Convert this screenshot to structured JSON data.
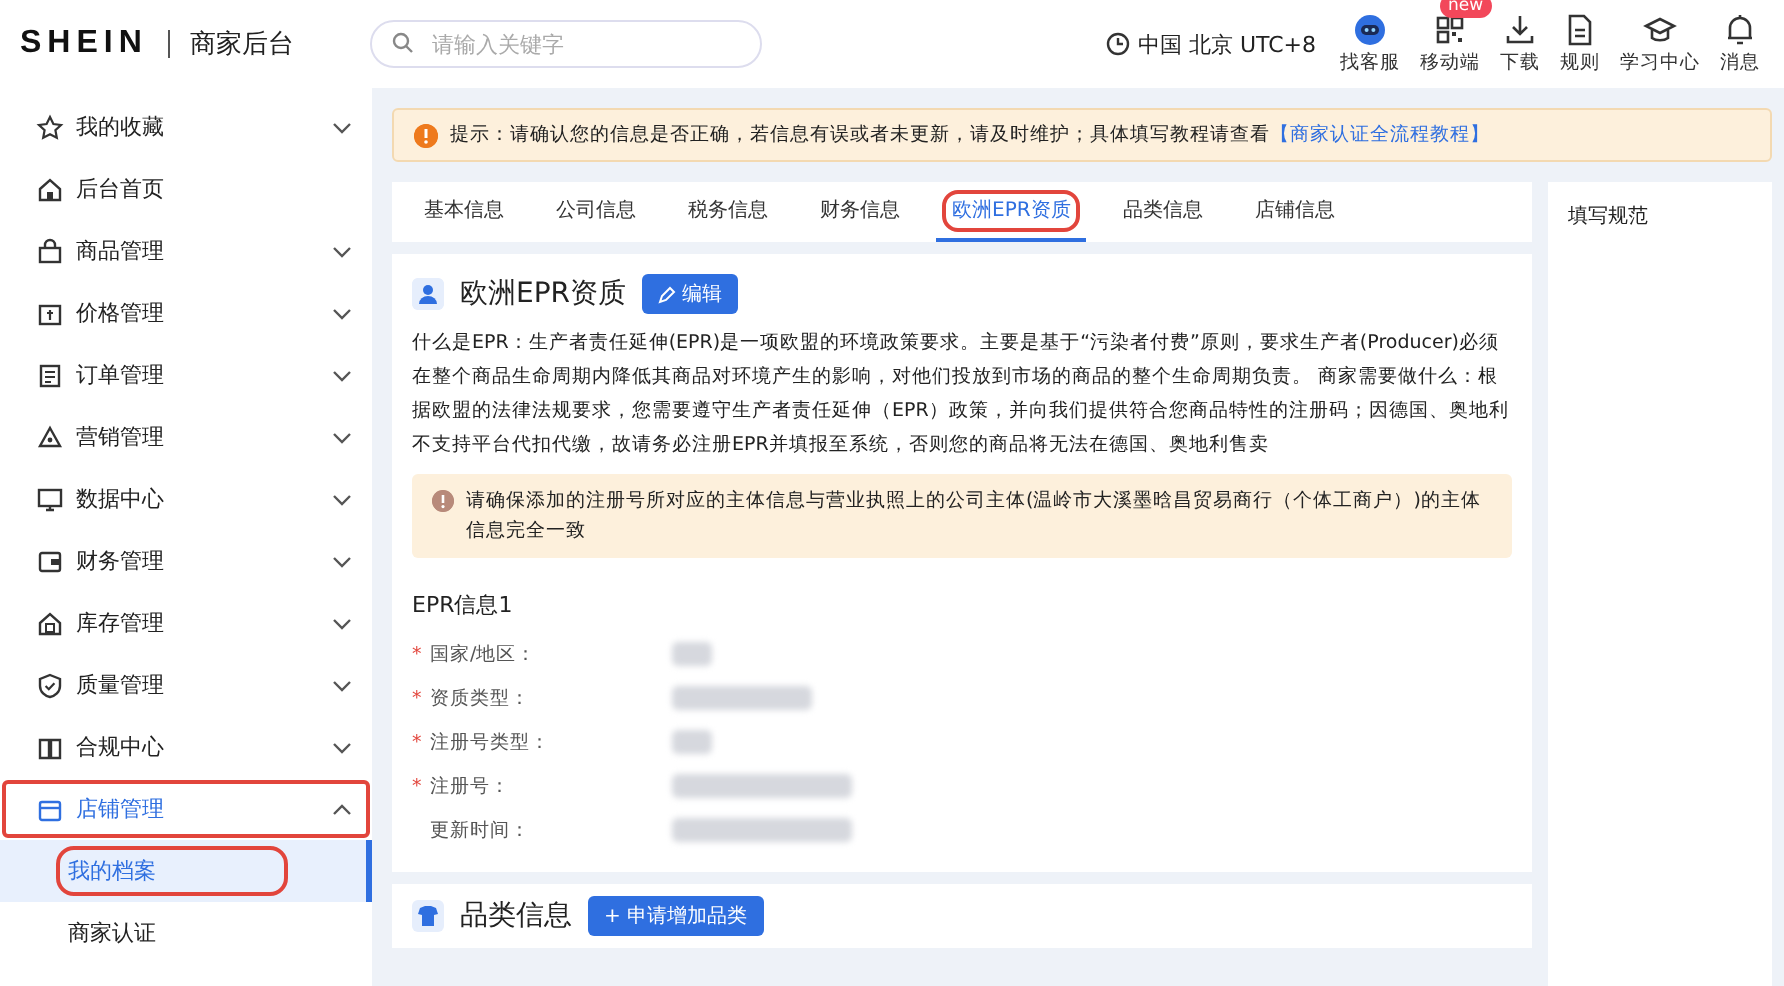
{
  "header": {
    "logo": "SHEIN",
    "title": "商家后台",
    "search": {
      "placeholder": "请输入关键字"
    },
    "timezone": "中国 北京 UTC+8",
    "tools": [
      {
        "kind": "robot",
        "label": "找客服"
      },
      {
        "kind": "qr",
        "label": "移动端",
        "badge": "new"
      },
      {
        "kind": "download",
        "label": "下载"
      },
      {
        "kind": "doc",
        "label": "规则"
      },
      {
        "kind": "cap",
        "label": "学习中心"
      },
      {
        "kind": "bell",
        "label": "消息"
      }
    ]
  },
  "sidebar": {
    "items": [
      {
        "kind": "star",
        "label": "我的收藏",
        "expandable": true,
        "expanded": false,
        "highlighted": false
      },
      {
        "kind": "home",
        "label": "后台首页",
        "expandable": false,
        "expanded": false,
        "highlighted": false
      },
      {
        "kind": "bag",
        "label": "商品管理",
        "expandable": true,
        "expanded": false,
        "highlighted": false
      },
      {
        "kind": "price",
        "label": "价格管理",
        "expandable": true,
        "expanded": false,
        "highlighted": false
      },
      {
        "kind": "order",
        "label": "订单管理",
        "expandable": true,
        "expanded": false,
        "highlighted": false
      },
      {
        "kind": "market",
        "label": "营销管理",
        "expandable": true,
        "expanded": false,
        "highlighted": false
      },
      {
        "kind": "data",
        "label": "数据中心",
        "expandable": true,
        "expanded": false,
        "highlighted": false
      },
      {
        "kind": "wallet",
        "label": "财务管理",
        "expandable": true,
        "expanded": false,
        "highlighted": false
      },
      {
        "kind": "stock",
        "label": "库存管理",
        "expandable": true,
        "expanded": false,
        "highlighted": false
      },
      {
        "kind": "shield",
        "label": "质量管理",
        "expandable": true,
        "expanded": false,
        "highlighted": false
      },
      {
        "kind": "book",
        "label": "合规中心",
        "expandable": true,
        "expanded": false,
        "highlighted": false
      },
      {
        "kind": "store",
        "label": "店铺管理",
        "expandable": true,
        "expanded": true,
        "highlighted": true,
        "children": [
          {
            "label": "我的档案",
            "selected": true,
            "highlighted": true
          },
          {
            "label": "商家认证",
            "selected": false,
            "highlighted": false
          }
        ]
      }
    ]
  },
  "notice": {
    "prefix": "提示：",
    "text": "请确认您的信息是否正确，若信息有误或者未更新，请及时维护；具体填写教程请查看",
    "link": "【商家认证全流程教程】"
  },
  "tabs": [
    {
      "label": "基本信息",
      "selected": false,
      "highlighted": false
    },
    {
      "label": "公司信息",
      "selected": false,
      "highlighted": false
    },
    {
      "label": "税务信息",
      "selected": false,
      "highlighted": false
    },
    {
      "label": "财务信息",
      "selected": false,
      "highlighted": false
    },
    {
      "label": "欧洲EPR资质",
      "selected": true,
      "highlighted": true
    },
    {
      "label": "品类信息",
      "selected": false,
      "highlighted": false
    },
    {
      "label": "店铺信息",
      "selected": false,
      "highlighted": false
    }
  ],
  "epr": {
    "title": "欧洲EPR资质",
    "edit_button": "编辑",
    "description": "什么是EPR：生产者责任延伸(EPR)是一项欧盟的环境政策要求。主要是基于“污染者付费”原则，要求生产者(Producer)必须在整个商品生命周期内降低其商品对环境产生的影响，对他们投放到市场的商品的整个生命周期负责。 商家需要做什么：根据欧盟的法律法规要求，您需要遵守生产者责任延伸（EPR）政策，并向我们提供符合您商品特性的注册码；因德国、奥地利不支持平台代扣代缴，故请务必注册EPR并填报至系统，否则您的商品将无法在德国、奥地利售卖",
    "warning": "请确保添加的注册号所对应的主体信息与营业执照上的公司主体(温岭市大溪墨晗昌贸易商行（个体工商户）)的主体信息完全一致",
    "section_title": "EPR信息1",
    "fields": [
      {
        "label": "国家/地区：",
        "required_mark": "*"
      },
      {
        "label": "资质类型：",
        "required_mark": "*"
      },
      {
        "label": "注册号类型：",
        "required_mark": "*"
      },
      {
        "label": "注册号：",
        "required_mark": "*"
      },
      {
        "label": "更新时间："
      }
    ]
  },
  "category": {
    "title": "品类信息",
    "button": "+ 申请增加品类"
  },
  "side_panel": {
    "title": "填写规范"
  }
}
